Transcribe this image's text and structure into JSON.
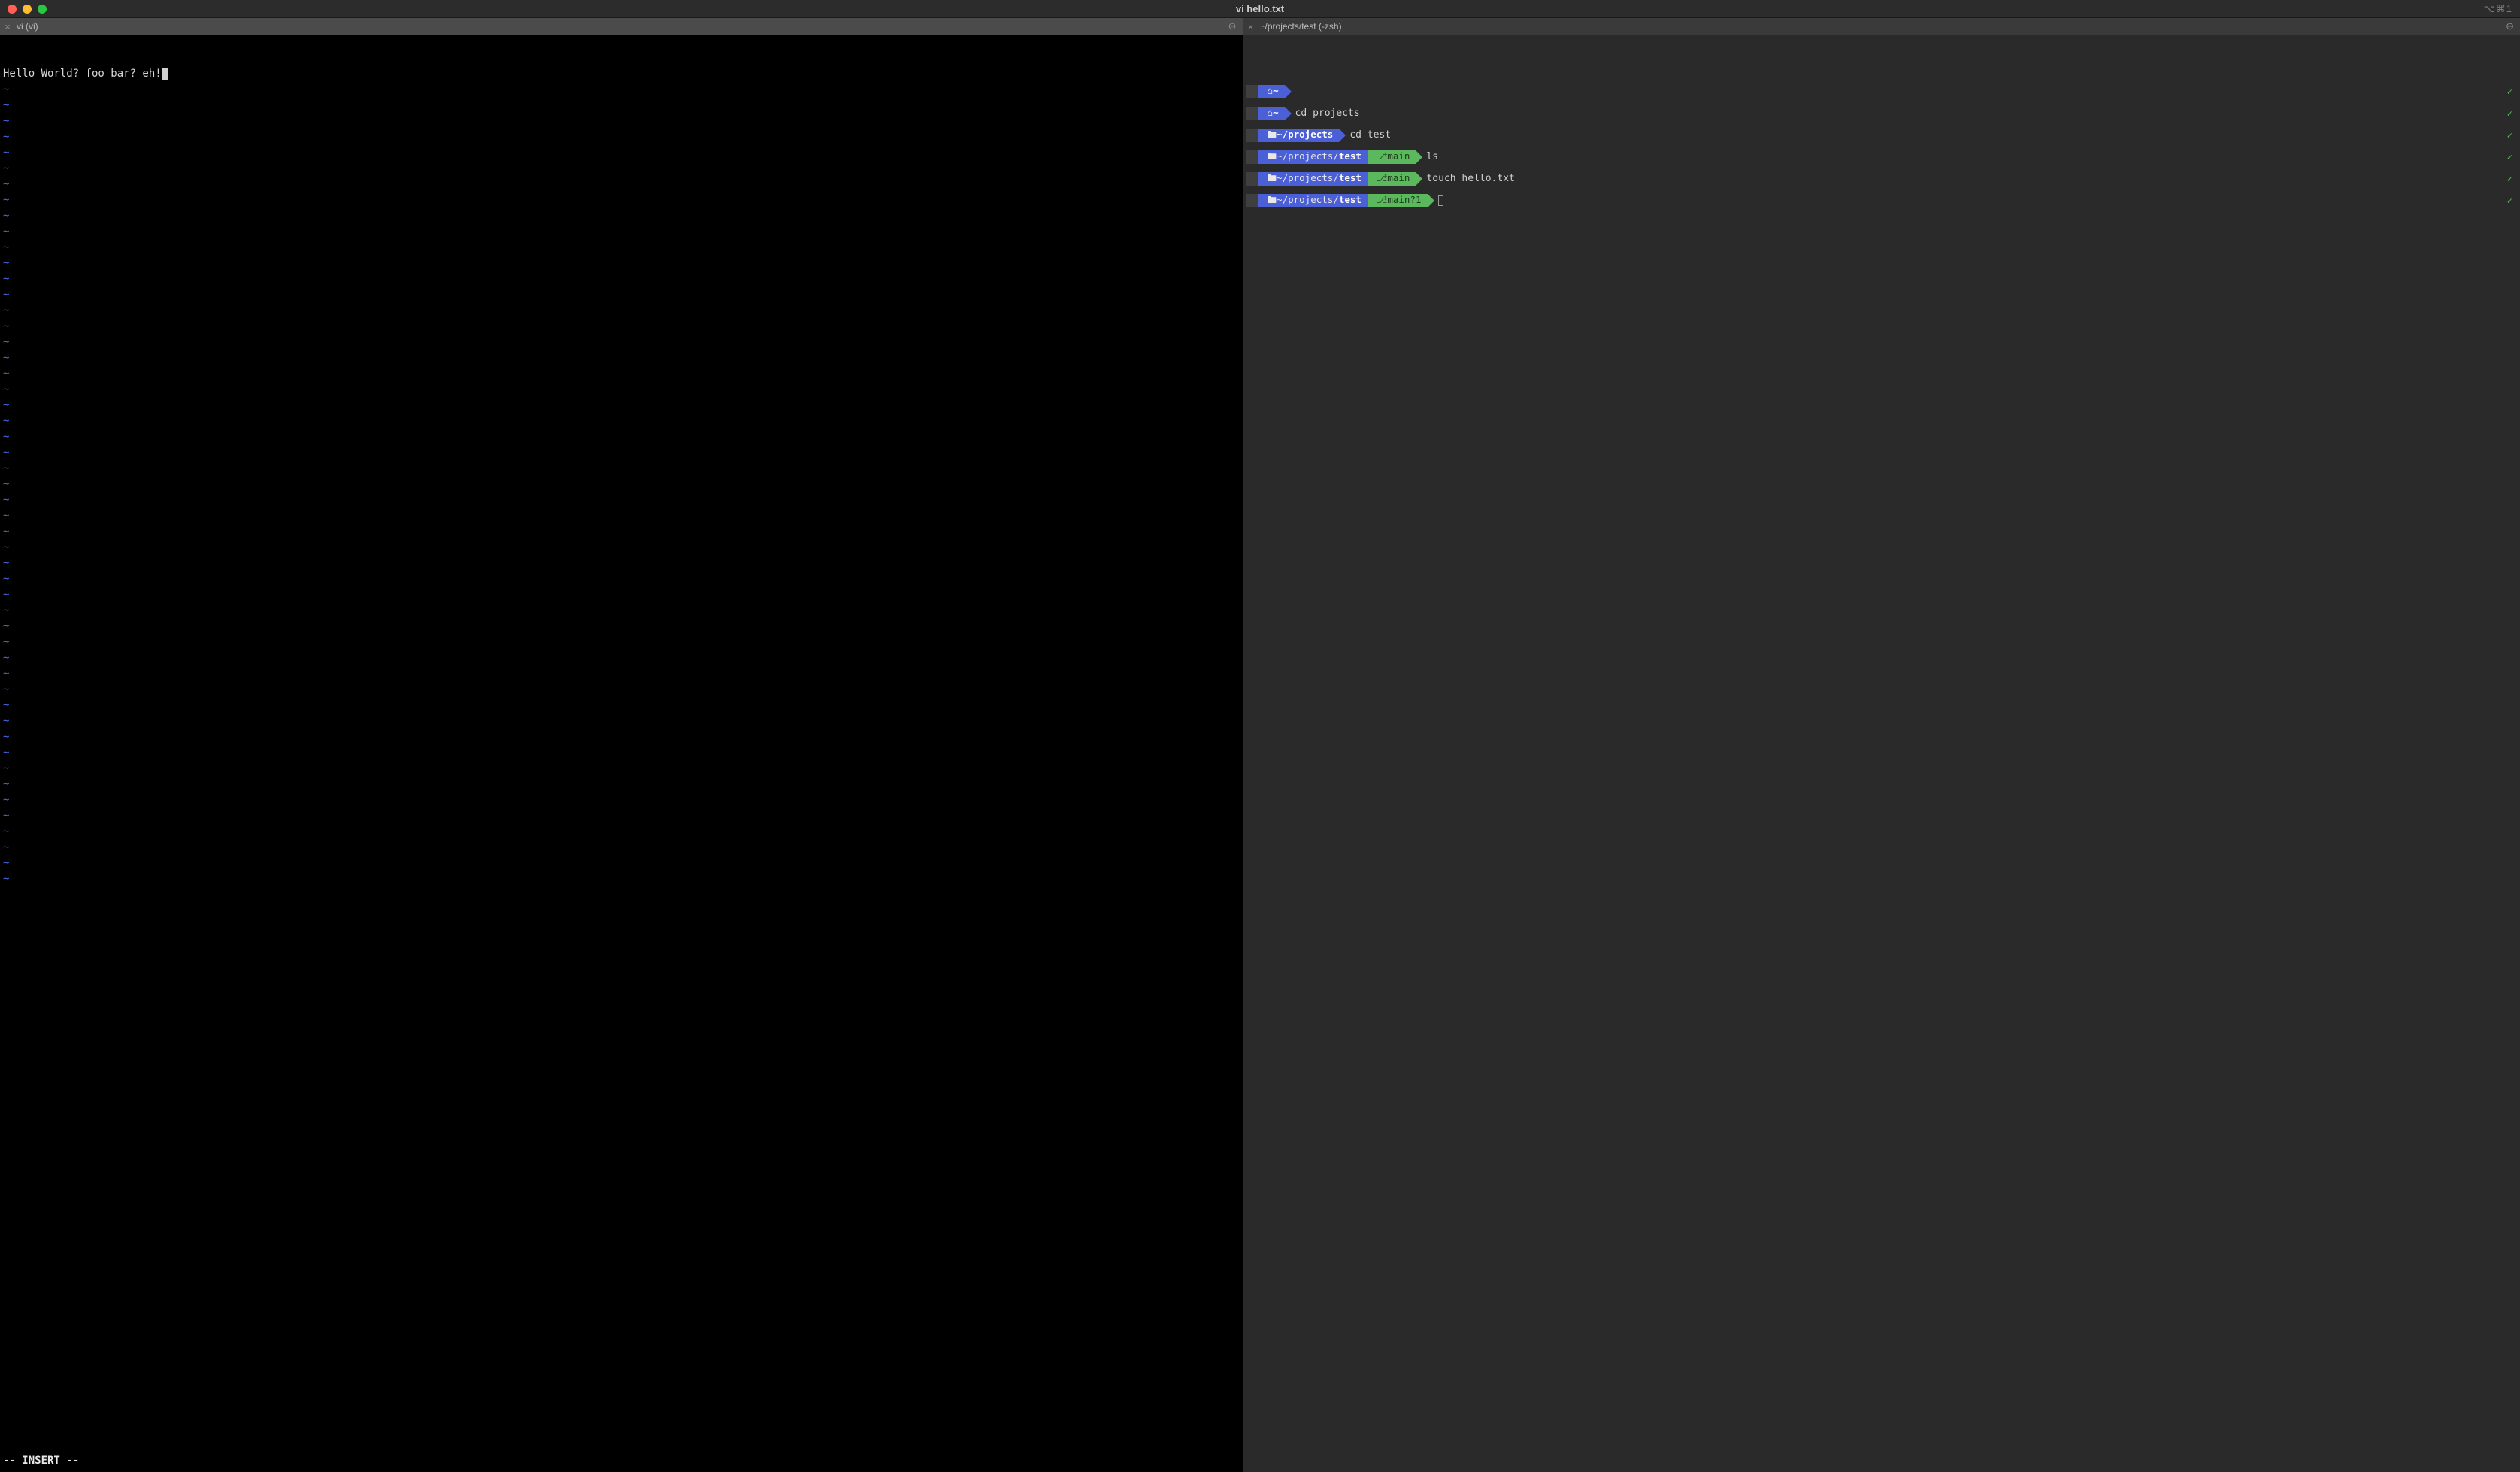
{
  "window": {
    "title": "vi hello.txt",
    "shortcut_indicator": "⌥⌘1"
  },
  "left_pane": {
    "tab_title": "vi (vi)",
    "content": "Hello World? foo bar? eh!",
    "tilde_rows": 51,
    "status": "-- INSERT --"
  },
  "right_pane": {
    "tab_title": "~/projects/test (-zsh)",
    "lines": [
      {
        "path_prefix": "",
        "path_bold": "~",
        "home_icon": true,
        "git": null,
        "git_extra": "",
        "command": "",
        "cursor": false
      },
      {
        "path_prefix": "",
        "path_bold": "~",
        "home_icon": true,
        "git": null,
        "git_extra": "",
        "command": "cd projects",
        "cursor": false
      },
      {
        "path_prefix": "",
        "path_bold": "~/projects",
        "home_icon": false,
        "git": null,
        "git_extra": "",
        "command": "cd test",
        "cursor": false
      },
      {
        "path_prefix": "~/projects/",
        "path_bold": "test",
        "home_icon": false,
        "git": "main",
        "git_extra": "",
        "command": "ls",
        "cursor": false
      },
      {
        "path_prefix": "~/projects/",
        "path_bold": "test",
        "home_icon": false,
        "git": "main",
        "git_extra": "",
        "command": "touch hello.txt",
        "cursor": false
      },
      {
        "path_prefix": "~/projects/",
        "path_bold": "test",
        "home_icon": false,
        "git": "main",
        "git_extra": "?1",
        "command": "",
        "cursor": true
      }
    ]
  },
  "icons": {
    "apple": "",
    "home": "⌂",
    "folder": "🖿",
    "git": "",
    "branch": "⎇"
  }
}
